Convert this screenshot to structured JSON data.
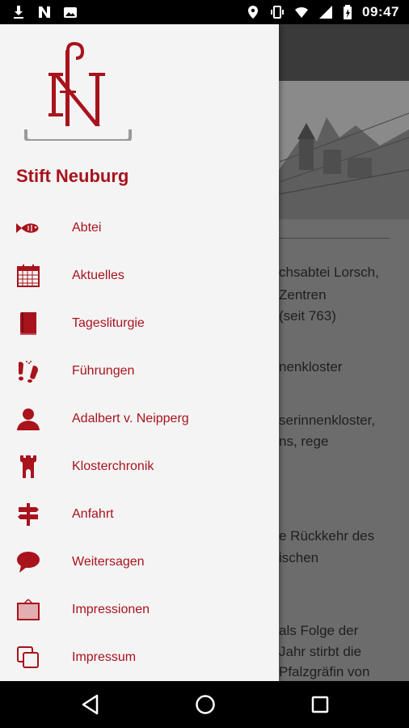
{
  "status_bar": {
    "time": "09:47",
    "left_icons": [
      "download-icon",
      "n-notification-icon",
      "photo-icon"
    ],
    "right_icons": [
      "location-icon",
      "vibrate-icon",
      "wifi-icon",
      "signal-icon",
      "battery-icon"
    ]
  },
  "drawer": {
    "title": "Stift Neuburg",
    "accent_color": "#a8131c",
    "items": [
      {
        "label": "Abtei",
        "icon": "fish-icon"
      },
      {
        "label": "Aktuelles",
        "icon": "calendar-icon"
      },
      {
        "label": "Tagesliturgie",
        "icon": "book-icon"
      },
      {
        "label": "Führungen",
        "icon": "footsteps-icon"
      },
      {
        "label": "Adalbert v. Neipperg",
        "icon": "person-icon"
      },
      {
        "label": "Klosterchronik",
        "icon": "tower-icon"
      },
      {
        "label": "Anfahrt",
        "icon": "signpost-icon"
      },
      {
        "label": "Weitersagen",
        "icon": "speech-bubble-icon"
      },
      {
        "label": "Impressionen",
        "icon": "picture-frame-icon"
      },
      {
        "label": "Impressum",
        "icon": "copy-icon"
      }
    ]
  },
  "background": {
    "lines": [
      "chsabtei Lorsch,",
      " Zentren",
      "(seit 763)",
      "nenkloster",
      "serinnenkloster,",
      "ns, rege",
      "e Rückkehr des",
      "ischen",
      " als Folge der",
      "Jahr stirbt die",
      "Pfalzgräfin von"
    ]
  },
  "navigation_bar": {
    "buttons": [
      "back-icon",
      "home-icon",
      "recents-icon"
    ]
  }
}
